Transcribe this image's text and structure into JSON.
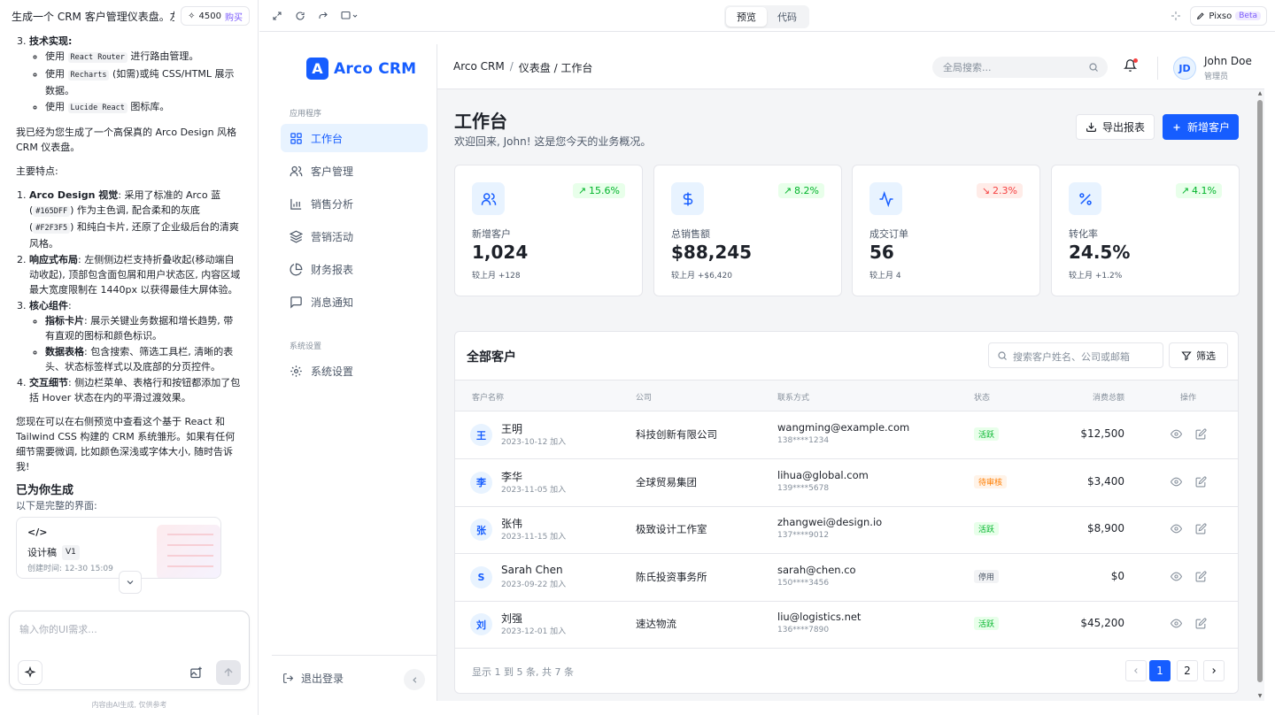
{
  "chat": {
    "title": "生成一个 CRM 客户管理仪表盘。左…",
    "credits": "4500",
    "buy_label": "购买",
    "tech_heading": "技术实现:",
    "tech_items": [
      {
        "pre": "使用",
        "code": "React Router",
        "post": "进行路由管理。"
      },
      {
        "pre": "使用",
        "code": "Recharts",
        "post": "(如需)或纯 CSS/HTML 展示数据。"
      },
      {
        "pre": "使用",
        "code": "Lucide React",
        "post": "图标库。"
      }
    ],
    "intro": "我已经为您生成了一个高保真的 Arco Design 风格 CRM 仪表盘。",
    "features_heading": "主要特点:",
    "f1_title": "Arco Design 视觉",
    "f1_text_a": ": 采用了标准的 Arco 蓝 (",
    "f1_code_a": "#165DFF",
    "f1_text_b": ") 作为主色调, 配合柔和的灰底 (",
    "f1_code_b": "#F2F3F5",
    "f1_text_c": ") 和纯白卡片, 还原了企业级后台的清爽风格。",
    "f2_title": "响应式布局",
    "f2_text": ": 左侧侧边栏支持折叠收起(移动端自动收起), 顶部包含面包屑和用户状态区, 内容区域最大宽度限制在 1440px 以获得最佳大屏体验。",
    "f3_title": "核心组件",
    "f3_sub1_title": "指标卡片",
    "f3_sub1_text": ": 展示关键业务数据和增长趋势, 带有直观的图标和颜色标识。",
    "f3_sub2_title": "数据表格",
    "f3_sub2_text": ": 包含搜索、筛选工具栏, 清晰的表头、状态标签样式以及底部的分页控件。",
    "f4_title": "交互细节",
    "f4_text": ": 侧边栏菜单、表格行和按钮都添加了包括 Hover 状态在内的平滑过渡效果。",
    "outro": "您现在可以在右侧预览中查看这个基于 React 和 Tailwind CSS 构建的 CRM 系统雏形。如果有任何细节需要微调, 比如颜色深浅或字体大小, 随时告诉我!",
    "generated_title": "已为你生成",
    "generated_sub": "以下是完整的界面:",
    "design_name": "设计稿",
    "design_version": "V1",
    "design_time": "创建时间: 12-30 15:09",
    "input_placeholder": "输入你的UI需求...",
    "disclaimer": "内容由AI生成, 仅供参考"
  },
  "toolbar": {
    "tab_preview": "预览",
    "tab_code": "代码",
    "pixso": "Pixso",
    "beta": "Beta"
  },
  "app": {
    "brand": "Arco CRM",
    "brand_letter": "A",
    "section_apps": "应用程序",
    "section_system": "系统设置",
    "nav": [
      {
        "label": "工作台",
        "icon": "dashboard-icon"
      },
      {
        "label": "客户管理",
        "icon": "users-icon"
      },
      {
        "label": "销售分析",
        "icon": "bar-chart-icon"
      },
      {
        "label": "营销活动",
        "icon": "layers-icon"
      },
      {
        "label": "财务报表",
        "icon": "pie-chart-icon"
      },
      {
        "label": "消息通知",
        "icon": "message-icon"
      }
    ],
    "settings": "系统设置",
    "logout": "退出登录",
    "breadcrumb": [
      "Arco CRM",
      "仪表盘 / 工作台"
    ],
    "search_placeholder": "全局搜索...",
    "user_initials": "JD",
    "user_name": "John Doe",
    "user_role": "管理员",
    "page_title": "工作台",
    "page_subtitle": "欢迎回来, John! 这是您今天的业务概况。",
    "export_label": "导出报表",
    "new_label": "新增客户",
    "accent": "#165DFF",
    "stats": [
      {
        "label": "新增客户",
        "value": "1,024",
        "trend": "15.6%",
        "dir": "up",
        "cmp_label": "较上月",
        "cmp_value": "+128",
        "icon": "users-icon"
      },
      {
        "label": "总销售额",
        "value": "$88,245",
        "trend": "8.2%",
        "dir": "up",
        "cmp_label": "较上月",
        "cmp_value": "+$6,420",
        "icon": "dollar-icon"
      },
      {
        "label": "成交订单",
        "value": "56",
        "trend": "2.3%",
        "dir": "down",
        "cmp_label": "较上月",
        "cmp_value": "4",
        "icon": "activity-icon"
      },
      {
        "label": "转化率",
        "value": "24.5%",
        "trend": "4.1%",
        "dir": "up",
        "cmp_label": "较上月",
        "cmp_value": "+1.2%",
        "icon": "percent-icon"
      }
    ],
    "table": {
      "title": "全部客户",
      "search_placeholder": "搜索客户姓名、公司或邮箱",
      "filter_label": "筛选",
      "columns": [
        "客户名称",
        "公司",
        "联系方式",
        "状态",
        "消费总额",
        "操作"
      ],
      "rows": [
        {
          "avatar": "王",
          "name": "王明",
          "joined": "2023-10-12 加入",
          "company": "科技创新有限公司",
          "email": "wangming@example.com",
          "phone": "138****1234",
          "status": "活跃",
          "status_type": "active",
          "amount": "$12,500"
        },
        {
          "avatar": "李",
          "name": "李华",
          "joined": "2023-11-05 加入",
          "company": "全球贸易集团",
          "email": "lihua@global.com",
          "phone": "139****5678",
          "status": "待审核",
          "status_type": "pending",
          "amount": "$3,400"
        },
        {
          "avatar": "张",
          "name": "张伟",
          "joined": "2023-11-15 加入",
          "company": "极致设计工作室",
          "email": "zhangwei@design.io",
          "phone": "137****9012",
          "status": "活跃",
          "status_type": "active",
          "amount": "$8,900"
        },
        {
          "avatar": "S",
          "name": "Sarah Chen",
          "joined": "2023-09-22 加入",
          "company": "陈氏投资事务所",
          "email": "sarah@chen.co",
          "phone": "150****3456",
          "status": "停用",
          "status_type": "off",
          "amount": "$0"
        },
        {
          "avatar": "刘",
          "name": "刘强",
          "joined": "2023-12-01 加入",
          "company": "速达物流",
          "email": "liu@logistics.net",
          "phone": "136****7890",
          "status": "活跃",
          "status_type": "active",
          "amount": "$45,200"
        }
      ],
      "pager_info": "显示 1 到 5 条, 共 7 条",
      "pages": [
        "1",
        "2"
      ],
      "current_page": "1"
    }
  }
}
